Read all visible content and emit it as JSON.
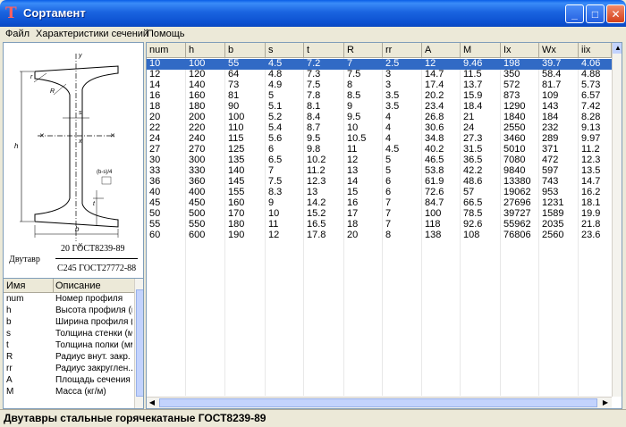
{
  "window": {
    "title": "Сортамент"
  },
  "menu": {
    "items": [
      "Файл",
      "Характеристики сечений",
      "Помощь"
    ]
  },
  "drawing": {
    "caption_top": "20 ГОСТ8239-89",
    "caption_left": "Двутавр",
    "caption_bottom": "С245 ГОСТ27772-88",
    "labels": {
      "y": "y",
      "x": "x",
      "h": "h",
      "b": "b",
      "s": "s",
      "t": "t",
      "r": "r",
      "R": "R",
      "slope": "(b-s)/4"
    }
  },
  "desc_table": {
    "headers": [
      "Имя",
      "Описание"
    ],
    "rows": [
      [
        "num",
        "Номер профиля"
      ],
      [
        "h",
        "Высота профиля (м"
      ],
      [
        "b",
        "Ширина профиля (."
      ],
      [
        "s",
        "Толщина стенки (м"
      ],
      [
        "t",
        "Толщина полки (мм"
      ],
      [
        "R",
        "Радиус внут. закр."
      ],
      [
        "rr",
        "Радиус закруглен.."
      ],
      [
        "A",
        "Площадь сечения ."
      ],
      [
        "M",
        "Масса (кг/м)"
      ]
    ]
  },
  "grid": {
    "headers": [
      "num",
      "h",
      "b",
      "s",
      "t",
      "R",
      "rr",
      "A",
      "M",
      "Ix",
      "Wx",
      "iix"
    ],
    "selected_row": 0,
    "rows": [
      [
        "10",
        "100",
        "55",
        "4.5",
        "7.2",
        "7",
        "2.5",
        "12",
        "9.46",
        "198",
        "39.7",
        "4.06"
      ],
      [
        "12",
        "120",
        "64",
        "4.8",
        "7.3",
        "7.5",
        "3",
        "14.7",
        "11.5",
        "350",
        "58.4",
        "4.88"
      ],
      [
        "14",
        "140",
        "73",
        "4.9",
        "7.5",
        "8",
        "3",
        "17.4",
        "13.7",
        "572",
        "81.7",
        "5.73"
      ],
      [
        "16",
        "160",
        "81",
        "5",
        "7.8",
        "8.5",
        "3.5",
        "20.2",
        "15.9",
        "873",
        "109",
        "6.57"
      ],
      [
        "18",
        "180",
        "90",
        "5.1",
        "8.1",
        "9",
        "3.5",
        "23.4",
        "18.4",
        "1290",
        "143",
        "7.42"
      ],
      [
        "20",
        "200",
        "100",
        "5.2",
        "8.4",
        "9.5",
        "4",
        "26.8",
        "21",
        "1840",
        "184",
        "8.28"
      ],
      [
        "22",
        "220",
        "110",
        "5.4",
        "8.7",
        "10",
        "4",
        "30.6",
        "24",
        "2550",
        "232",
        "9.13"
      ],
      [
        "24",
        "240",
        "115",
        "5.6",
        "9.5",
        "10.5",
        "4",
        "34.8",
        "27.3",
        "3460",
        "289",
        "9.97"
      ],
      [
        "27",
        "270",
        "125",
        "6",
        "9.8",
        "11",
        "4.5",
        "40.2",
        "31.5",
        "5010",
        "371",
        "11.2"
      ],
      [
        "30",
        "300",
        "135",
        "6.5",
        "10.2",
        "12",
        "5",
        "46.5",
        "36.5",
        "7080",
        "472",
        "12.3"
      ],
      [
        "33",
        "330",
        "140",
        "7",
        "11.2",
        "13",
        "5",
        "53.8",
        "42.2",
        "9840",
        "597",
        "13.5"
      ],
      [
        "36",
        "360",
        "145",
        "7.5",
        "12.3",
        "14",
        "6",
        "61.9",
        "48.6",
        "13380",
        "743",
        "14.7"
      ],
      [
        "40",
        "400",
        "155",
        "8.3",
        "13",
        "15",
        "6",
        "72.6",
        "57",
        "19062",
        "953",
        "16.2"
      ],
      [
        "45",
        "450",
        "160",
        "9",
        "14.2",
        "16",
        "7",
        "84.7",
        "66.5",
        "27696",
        "1231",
        "18.1"
      ],
      [
        "50",
        "500",
        "170",
        "10",
        "15.2",
        "17",
        "7",
        "100",
        "78.5",
        "39727",
        "1589",
        "19.9"
      ],
      [
        "55",
        "550",
        "180",
        "11",
        "16.5",
        "18",
        "7",
        "118",
        "92.6",
        "55962",
        "2035",
        "21.8"
      ],
      [
        "60",
        "600",
        "190",
        "12",
        "17.8",
        "20",
        "8",
        "138",
        "108",
        "76806",
        "2560",
        "23.6"
      ]
    ]
  },
  "status": {
    "text": "Двутавры стальные горячекатаные ГОСТ8239-89"
  }
}
